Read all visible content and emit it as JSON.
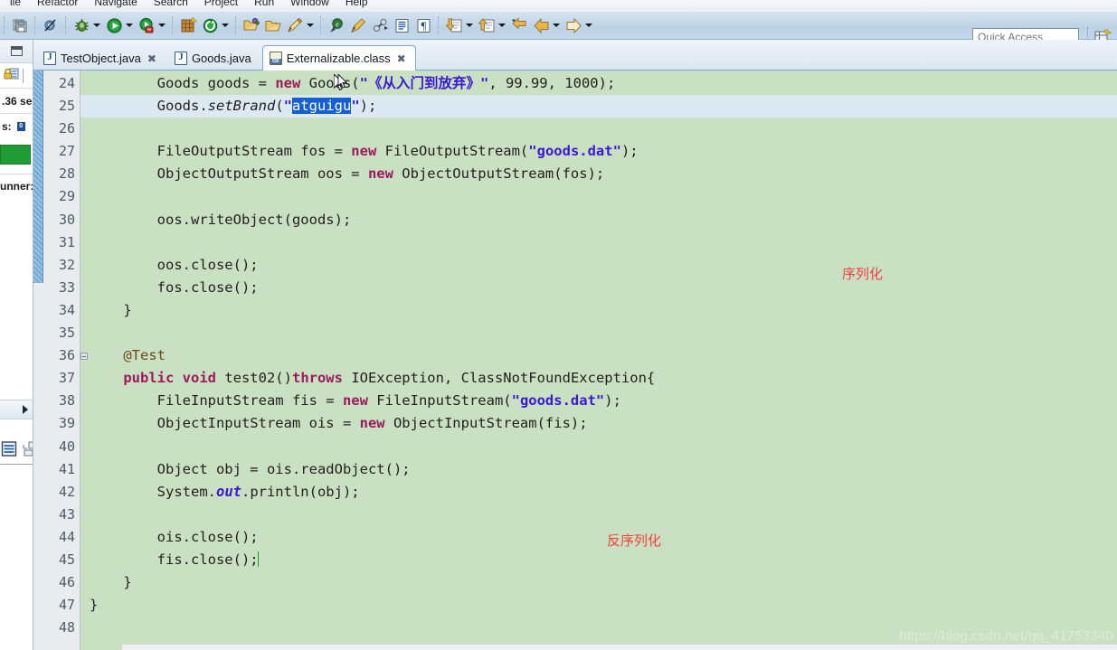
{
  "menubar": {
    "items": [
      "ile",
      "Refactor",
      "Navigate",
      "Search",
      "Project",
      "Run",
      "Window",
      "Help"
    ]
  },
  "toolbar": {
    "icons": [
      "save-all-icon",
      "skip-breakpoints-icon",
      "debug-icon",
      "debug-dropdown-icon",
      "run-icon",
      "run-dropdown-icon",
      "run-coverage-icon",
      "run-coverage-dropdown-icon",
      "new-java-package-icon",
      "external-tools-icon",
      "external-tools-dropdown-icon",
      "open-type-icon",
      "open-task-icon",
      "search-icon",
      "search-dropdown-icon",
      "toggle-mark-occurrences-icon",
      "pencil-icon",
      "link-icon",
      "show-whitespace-icon",
      "pilcrow-icon",
      "next-annotation-icon",
      "next-annotation-dropdown-icon",
      "previous-annotation-icon",
      "previous-annotation-dropdown-icon",
      "last-edit-location-icon",
      "back-icon",
      "back-dropdown-icon",
      "forward-icon",
      "forward-dropdown-icon"
    ],
    "quick_access_placeholder": "Quick Access",
    "open_perspective_label": "open-perspective-icon"
  },
  "left_view": {
    "minimize_label": "minimize-view-icon",
    "lock_icon": "lock-icon",
    "layout_icon": "layout-icon",
    "elapsed_time": ".36 se",
    "errors_label": "s:",
    "errors_badge": "0",
    "progress_color": "#1f9c33",
    "runner_label": "unner:",
    "scroll_arrow": "scroll-right-arrow-icon"
  },
  "editor": {
    "tabs": [
      {
        "label": "TestObject.java",
        "icon": "java-file-icon",
        "closable": true,
        "selected": false
      },
      {
        "label": "Goods.java",
        "icon": "java-file-icon",
        "closable": false,
        "selected": false
      },
      {
        "label": "Externalizable.class",
        "icon": "class-file-icon",
        "closable": true,
        "selected": true
      }
    ],
    "current_line": 25,
    "selection_text": "atguigu",
    "background": "#c9e0c2",
    "current_line_background": "#dde9f2",
    "lines": [
      {
        "n": 24,
        "fold": false,
        "current": false,
        "tokens": [
          {
            "t": "        ",
            "c": "pln"
          },
          {
            "t": "Goods goods = ",
            "c": "pln"
          },
          {
            "t": "new",
            "c": "kw"
          },
          {
            "t": " Goods(",
            "c": "pln"
          },
          {
            "t": "\"《从入门到放弃》\"",
            "c": "str"
          },
          {
            "t": ", 99.99, 1000);",
            "c": "pln"
          }
        ]
      },
      {
        "n": 25,
        "fold": false,
        "current": true,
        "tokens": [
          {
            "t": "        Goods.",
            "c": "pln"
          },
          {
            "t": "setBrand",
            "c": "mth"
          },
          {
            "t": "(",
            "c": "pln"
          },
          {
            "t": "\"",
            "c": "str"
          },
          {
            "t": "atguigu",
            "c": "sel"
          },
          {
            "t": "\"",
            "c": "str"
          },
          {
            "t": ");",
            "c": "pln"
          }
        ]
      },
      {
        "n": 26,
        "fold": false,
        "current": false,
        "tokens": []
      },
      {
        "n": 27,
        "fold": false,
        "current": false,
        "tokens": [
          {
            "t": "        FileOutputStream fos = ",
            "c": "pln"
          },
          {
            "t": "new",
            "c": "kw"
          },
          {
            "t": " FileOutputStream(",
            "c": "pln"
          },
          {
            "t": "\"goods.dat\"",
            "c": "str"
          },
          {
            "t": ");",
            "c": "pln"
          }
        ]
      },
      {
        "n": 28,
        "fold": false,
        "current": false,
        "tokens": [
          {
            "t": "        ObjectOutputStream oos = ",
            "c": "pln"
          },
          {
            "t": "new",
            "c": "kw"
          },
          {
            "t": " ObjectOutputStream(fos);",
            "c": "pln"
          }
        ]
      },
      {
        "n": 29,
        "fold": false,
        "current": false,
        "tokens": []
      },
      {
        "n": 30,
        "fold": false,
        "current": false,
        "tokens": [
          {
            "t": "        oos.writeObject(goods);",
            "c": "pln"
          }
        ]
      },
      {
        "n": 31,
        "fold": false,
        "current": false,
        "tokens": []
      },
      {
        "n": 32,
        "fold": false,
        "current": false,
        "tokens": [
          {
            "t": "        oos.close();",
            "c": "pln"
          }
        ]
      },
      {
        "n": 33,
        "fold": false,
        "current": false,
        "tokens": [
          {
            "t": "        fos.close();",
            "c": "pln"
          }
        ]
      },
      {
        "n": 34,
        "fold": false,
        "current": false,
        "tokens": [
          {
            "t": "    }",
            "c": "pln"
          }
        ]
      },
      {
        "n": 35,
        "fold": false,
        "current": false,
        "tokens": []
      },
      {
        "n": 36,
        "fold": true,
        "current": false,
        "tokens": [
          {
            "t": "    ",
            "c": "pln"
          },
          {
            "t": "@Test",
            "c": "ann"
          }
        ]
      },
      {
        "n": 37,
        "fold": false,
        "current": false,
        "tokens": [
          {
            "t": "    ",
            "c": "pln"
          },
          {
            "t": "public void",
            "c": "kw"
          },
          {
            "t": " test02()",
            "c": "pln"
          },
          {
            "t": "throws",
            "c": "kw"
          },
          {
            "t": " IOException, ClassNotFoundException{",
            "c": "pln"
          }
        ]
      },
      {
        "n": 38,
        "fold": false,
        "current": false,
        "tokens": [
          {
            "t": "        FileInputStream fis = ",
            "c": "pln"
          },
          {
            "t": "new",
            "c": "kw"
          },
          {
            "t": " FileInputStream(",
            "c": "pln"
          },
          {
            "t": "\"goods.dat\"",
            "c": "str"
          },
          {
            "t": ");",
            "c": "pln"
          }
        ]
      },
      {
        "n": 39,
        "fold": false,
        "current": false,
        "tokens": [
          {
            "t": "        ObjectInputStream ois = ",
            "c": "pln"
          },
          {
            "t": "new",
            "c": "kw"
          },
          {
            "t": " ObjectInputStream(fis);",
            "c": "pln"
          }
        ]
      },
      {
        "n": 40,
        "fold": false,
        "current": false,
        "tokens": []
      },
      {
        "n": 41,
        "fold": false,
        "current": false,
        "tokens": [
          {
            "t": "        Object obj = ois.readObject();",
            "c": "pln"
          }
        ]
      },
      {
        "n": 42,
        "fold": false,
        "current": false,
        "tokens": [
          {
            "t": "        System.",
            "c": "pln"
          },
          {
            "t": "out",
            "c": "fld"
          },
          {
            "t": ".println(obj);",
            "c": "pln"
          }
        ]
      },
      {
        "n": 43,
        "fold": false,
        "current": false,
        "tokens": []
      },
      {
        "n": 44,
        "fold": false,
        "current": false,
        "tokens": [
          {
            "t": "        ois.close();",
            "c": "pln"
          }
        ]
      },
      {
        "n": 45,
        "fold": false,
        "current": false,
        "caret": true,
        "tokens": [
          {
            "t": "        fis.close();",
            "c": "pln"
          }
        ]
      },
      {
        "n": 46,
        "fold": false,
        "current": false,
        "tokens": [
          {
            "t": "    }",
            "c": "pln"
          }
        ]
      },
      {
        "n": 47,
        "fold": false,
        "current": false,
        "tokens": [
          {
            "t": "}",
            "c": "pln"
          }
        ]
      },
      {
        "n": 48,
        "fold": false,
        "current": false,
        "tokens": []
      }
    ],
    "annotations": [
      {
        "text": "序列化",
        "color": "#f0413c",
        "name": "serialize-note"
      },
      {
        "text": "反序列化",
        "color": "#f0413c",
        "name": "deserialize-note"
      }
    ]
  },
  "watermark": {
    "text": "https://blog.csdn.net/qq_41753340"
  }
}
